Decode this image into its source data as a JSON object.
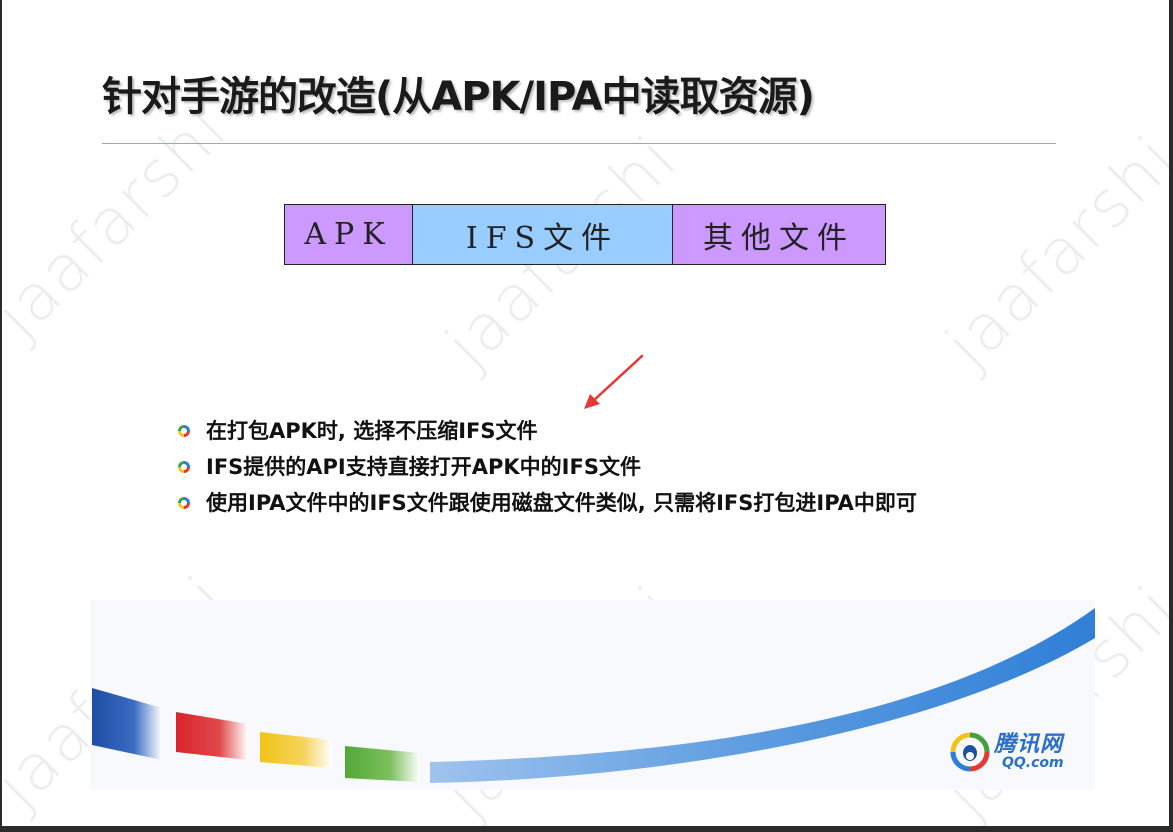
{
  "slide": {
    "title": "针对手游的改造(从APK/IPA中读取资源)",
    "diagram": {
      "segments": [
        {
          "label": "APK",
          "color": "#cc99ff"
        },
        {
          "label": "IFS文件",
          "color": "#99ccff"
        },
        {
          "label": "其他文件",
          "color": "#cc99ff"
        }
      ]
    },
    "bullets": [
      "在打包APK时, 选择不压缩IFS文件",
      "IFS提供的API支持直接打开APK中的IFS文件",
      "使用IPA文件中的IFS文件跟使用磁盘文件类似, 只需将IFS打包进IPA中即可"
    ],
    "arrow_color": "#e53935",
    "logo": {
      "cn": "腾讯网",
      "en": "QQ.com"
    },
    "watermark": "jaafarshi",
    "decor_colors": [
      "#1f4ea3",
      "#d7262b",
      "#f2c318",
      "#53a836",
      "#4a8fdb"
    ]
  }
}
